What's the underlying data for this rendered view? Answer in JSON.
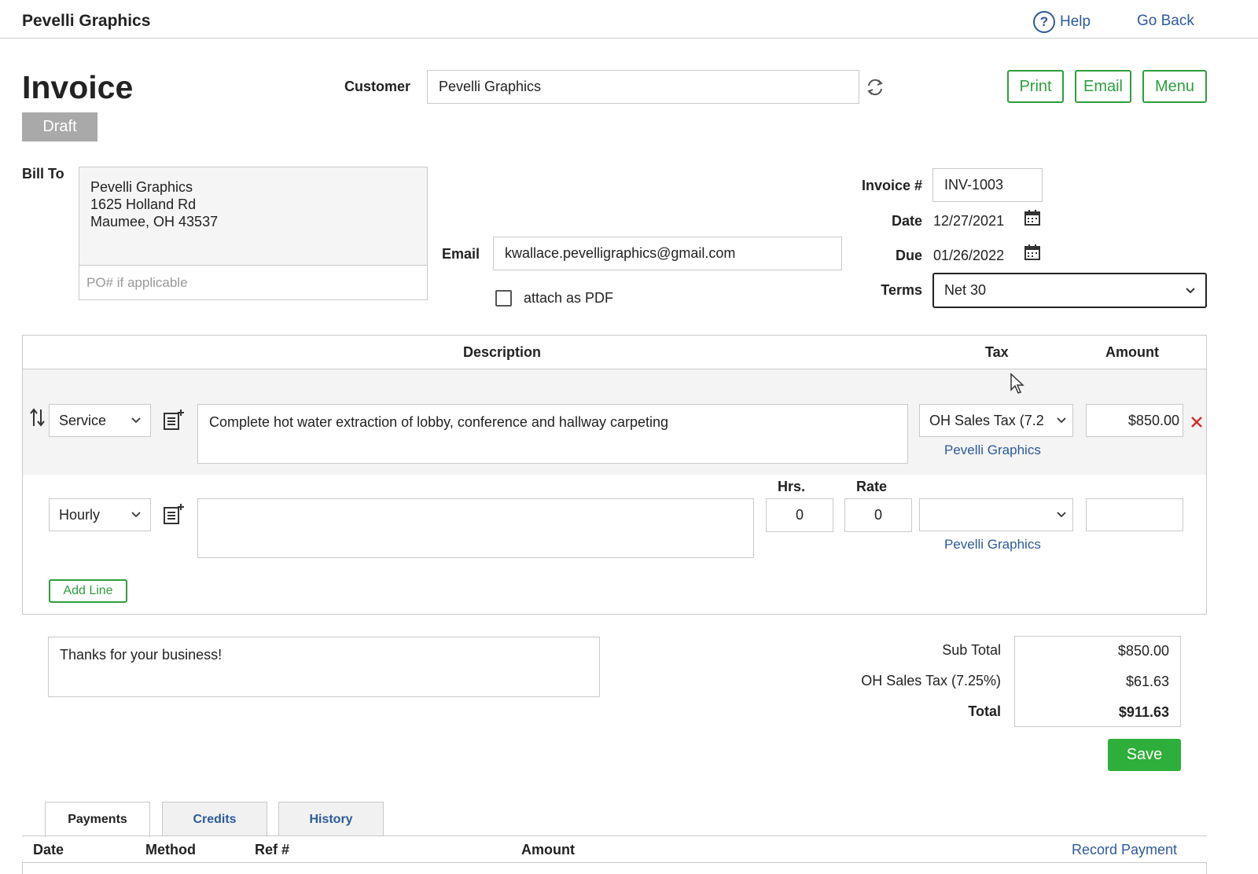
{
  "app": {
    "title": "Pevelli Graphics",
    "help_label": "Help",
    "goback_label": "Go Back"
  },
  "header": {
    "page_title": "Invoice",
    "status": "Draft",
    "customer_label": "Customer",
    "customer_value": "Pevelli Graphics",
    "print_label": "Print",
    "email_label": "Email",
    "menu_label": "Menu"
  },
  "bill_to": {
    "label": "Bill To",
    "address_lines": [
      "Pevelli Graphics",
      "1625 Holland Rd",
      "Maumee, OH 43537"
    ],
    "po_placeholder": "PO# if applicable"
  },
  "email": {
    "label": "Email",
    "value": "kwallace.pevelligraphics@gmail.com",
    "attach_label": "attach as PDF",
    "attach_checked": false
  },
  "meta": {
    "invoice_num_label": "Invoice #",
    "invoice_num": "INV-1003",
    "date_label": "Date",
    "date": "12/27/2021",
    "due_label": "Due",
    "due": "01/26/2022",
    "terms_label": "Terms",
    "terms": "Net 30"
  },
  "items": {
    "headers": {
      "description": "Description",
      "tax": "Tax",
      "amount": "Amount"
    },
    "rows": [
      {
        "type": "Service",
        "description": "Complete hot water extraction of lobby, conference and hallway carpeting",
        "tax": "OH Sales Tax (7.2",
        "tax_party": "Pevelli Graphics",
        "amount": "$850.00"
      },
      {
        "type": "Hourly",
        "description": "",
        "hrs_label": "Hrs.",
        "hrs": "0",
        "rate_label": "Rate",
        "rate": "0",
        "tax": "",
        "tax_party": "Pevelli Graphics",
        "amount": ""
      }
    ],
    "add_line_label": "Add Line"
  },
  "notes": "Thanks for your business!",
  "totals": {
    "subtotal_label": "Sub Total",
    "subtotal": "$850.00",
    "tax_label": "OH Sales Tax (7.25%)",
    "tax": "$61.63",
    "total_label": "Total",
    "total": "$911.63",
    "save_label": "Save"
  },
  "tabs": {
    "payments": "Payments",
    "credits": "Credits",
    "history": "History"
  },
  "payments_table": {
    "headers": {
      "date": "Date",
      "method": "Method",
      "ref": "Ref #",
      "amount": "Amount"
    },
    "record_payment_label": "Record Payment"
  },
  "colors": {
    "accent_green": "#2e9e3e",
    "link_blue": "#2d5a9b",
    "delete_red": "#d0302f",
    "draft_gray": "#a9a9a9"
  }
}
